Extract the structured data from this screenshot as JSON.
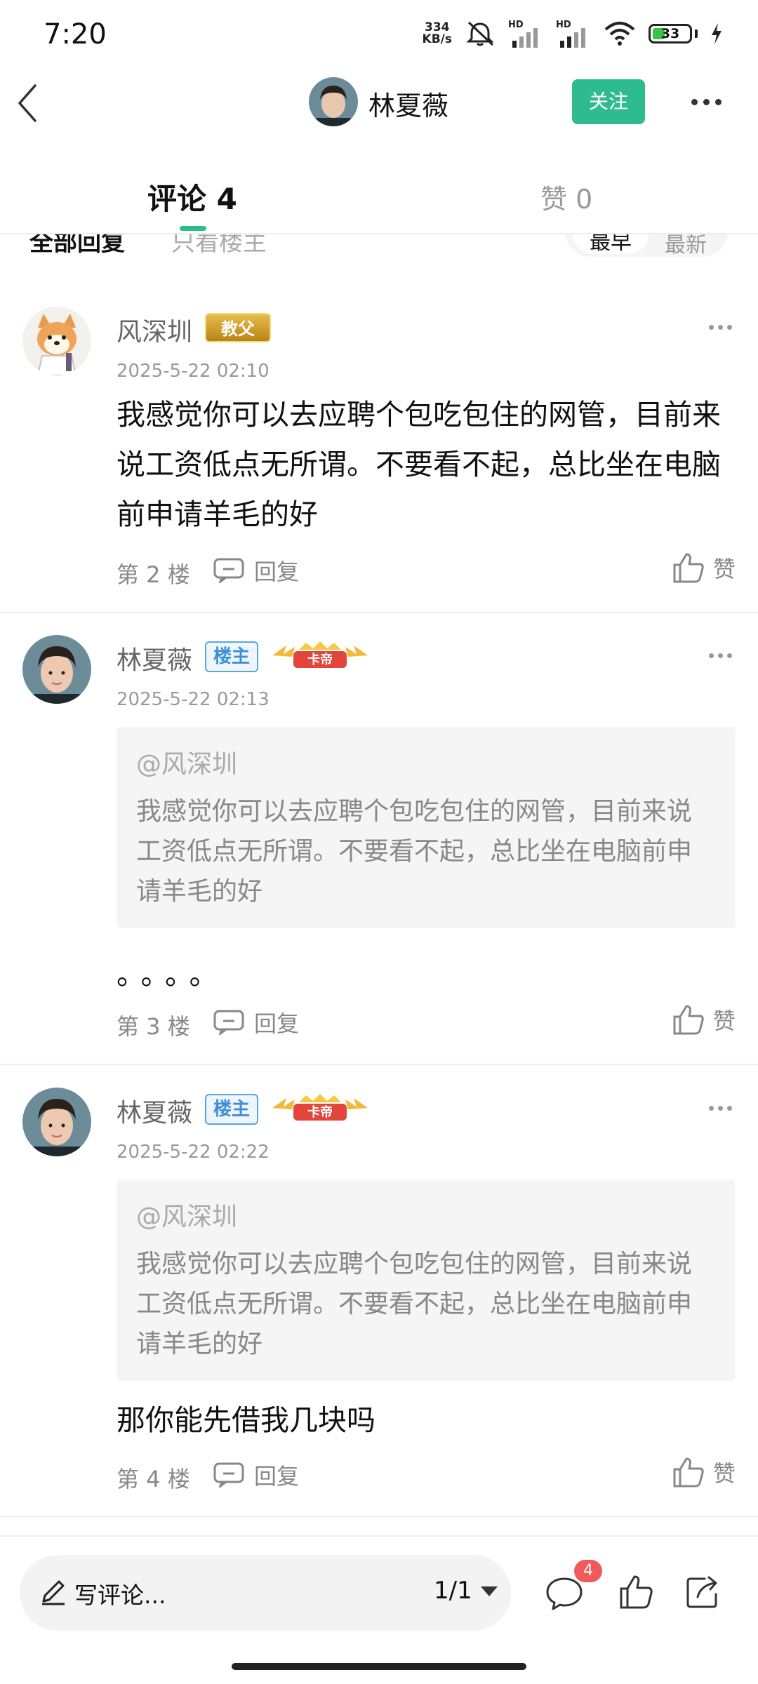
{
  "status_bar": {
    "time": "7:20",
    "net_speed_value": "334",
    "net_speed_unit": "KB/s",
    "hd_label": "HD",
    "battery": "33",
    "battery_level": 0.33
  },
  "header": {
    "user_name": "林夏薇",
    "follow_label": "关注"
  },
  "tabs": {
    "comments": "评论 4",
    "likes": "赞 0"
  },
  "filter": {
    "all": "全部回复",
    "op_only": "只看楼主",
    "sort_earliest": "最早",
    "sort_newest": "最新"
  },
  "comments": [
    {
      "user": "风深圳",
      "badge": "教父",
      "time": "2025-5-22 02:10",
      "body": "我感觉你可以去应聘个包吃包住的网管，目前来说工资低点无所谓。不要看不起，总比坐在电脑前申请羊毛的好",
      "floor": "第 2 楼",
      "reply": "回复",
      "like": "赞"
    },
    {
      "user": "林夏薇",
      "op_badge": "楼主",
      "badge": "卡帝",
      "time": "2025-5-22 02:13",
      "quote_user": "@风深圳",
      "quote_text": "我感觉你可以去应聘个包吃包住的网管，目前来说工资低点无所谓。不要看不起，总比坐在电脑前申请羊毛的好",
      "body": "。。。。",
      "floor": "第 3 楼",
      "reply": "回复",
      "like": "赞"
    },
    {
      "user": "林夏薇",
      "op_badge": "楼主",
      "badge": "卡帝",
      "time": "2025-5-22 02:22",
      "quote_user": "@风深圳",
      "quote_text": "我感觉你可以去应聘个包吃包住的网管，目前来说工资低点无所谓。不要看不起，总比坐在电脑前申请羊毛的好",
      "body": "那你能先借我几块吗",
      "floor": "第 4 楼",
      "reply": "回复",
      "like": "赞"
    }
  ],
  "bottom_bar": {
    "placeholder": "写评论...",
    "page": "1/1",
    "comment_count": "4"
  },
  "colors": {
    "accent": "#2ebc8e",
    "op_badge": "#3d8fd6",
    "count_badge": "#f05a5a"
  },
  "icons": [
    "back-arrow-icon",
    "more-dots-icon",
    "reply-icon",
    "like-thumb-icon",
    "pencil-icon",
    "comment-bubble-icon",
    "share-icon",
    "wifi-icon",
    "mute-icon",
    "charging-icon"
  ]
}
